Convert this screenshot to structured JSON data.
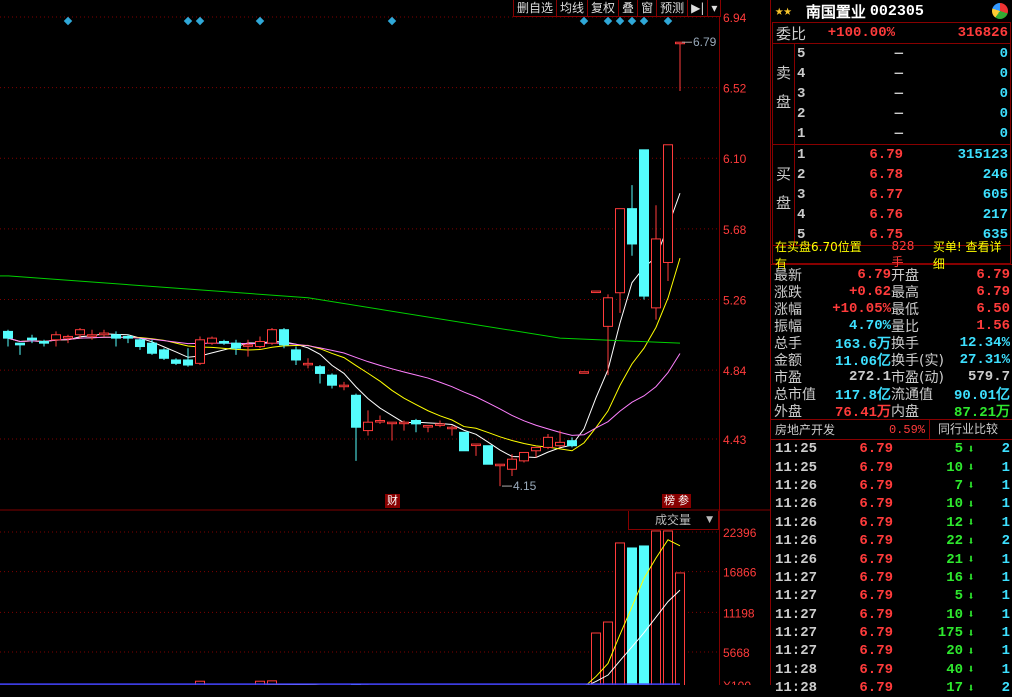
{
  "toolbar": {
    "items": [
      "删自选",
      "均线",
      "复权",
      "叠",
      "窗",
      "预测"
    ],
    "arrow_icon": "expand-right-icon",
    "dropdown_icon": "chevron-down-icon"
  },
  "price_axis": {
    "ticks": [
      "6.94",
      "6.52",
      "6.10",
      "5.68",
      "5.26",
      "4.84",
      "4.43"
    ],
    "max": 6.94,
    "min": 4.43
  },
  "annotations": {
    "high_label": "6.79",
    "low_label": "4.15",
    "finance_badge": "财",
    "rank_badge": "榜",
    "ref_badge": "参"
  },
  "colors": {
    "up": "#ff3b3b",
    "down": "#54fcfc",
    "ma5": "#ffffff",
    "ma10": "#ffff00",
    "ma20": "#ff80ff",
    "ma60": "#00d000",
    "grid": "#800000",
    "diamond": "#2fa8d8"
  },
  "event_marker_candles": [
    5,
    15,
    16,
    21,
    32,
    48,
    50,
    51,
    52,
    53,
    55
  ],
  "candles": [
    [
      5.07,
      5.08,
      4.98,
      5.03
    ],
    [
      5.0,
      5.0,
      4.93,
      4.99
    ],
    [
      5.03,
      5.05,
      5.0,
      5.02
    ],
    [
      5.01,
      5.02,
      4.98,
      5.0
    ],
    [
      5.02,
      5.07,
      4.98,
      5.05
    ],
    [
      5.03,
      5.05,
      5.0,
      5.04
    ],
    [
      5.05,
      5.09,
      5.03,
      5.08
    ],
    [
      5.05,
      5.08,
      5.02,
      5.05
    ],
    [
      5.05,
      5.08,
      5.04,
      5.06
    ],
    [
      5.05,
      5.07,
      4.98,
      5.03
    ],
    [
      5.04,
      5.05,
      5.0,
      5.03
    ],
    [
      5.02,
      5.03,
      4.96,
      4.98
    ],
    [
      5.0,
      5.02,
      4.93,
      4.94
    ],
    [
      4.96,
      4.97,
      4.9,
      4.91
    ],
    [
      4.9,
      4.91,
      4.87,
      4.88
    ],
    [
      4.9,
      4.97,
      4.86,
      4.87
    ],
    [
      4.88,
      5.04,
      4.87,
      5.02
    ],
    [
      5.0,
      5.04,
      4.99,
      5.03
    ],
    [
      5.01,
      5.02,
      4.99,
      5.0
    ],
    [
      5.0,
      5.02,
      4.93,
      4.97
    ],
    [
      4.99,
      5.02,
      4.92,
      4.99
    ],
    [
      4.98,
      5.04,
      4.97,
      5.01
    ],
    [
      5.0,
      5.09,
      4.99,
      5.08
    ],
    [
      5.08,
      5.09,
      4.97,
      4.99
    ],
    [
      4.96,
      4.98,
      4.87,
      4.9
    ],
    [
      4.88,
      4.91,
      4.85,
      4.88
    ],
    [
      4.86,
      4.87,
      4.76,
      4.82
    ],
    [
      4.81,
      4.82,
      4.73,
      4.75
    ],
    [
      4.75,
      4.77,
      4.72,
      4.75
    ],
    [
      4.69,
      4.7,
      4.3,
      4.5
    ],
    [
      4.48,
      4.6,
      4.45,
      4.53
    ],
    [
      4.54,
      4.57,
      4.52,
      4.54
    ],
    [
      4.53,
      4.53,
      4.42,
      4.53
    ],
    [
      4.53,
      4.54,
      4.48,
      4.53
    ],
    [
      4.54,
      4.55,
      4.47,
      4.52
    ],
    [
      4.51,
      4.51,
      4.47,
      4.51
    ],
    [
      4.52,
      4.54,
      4.5,
      4.52
    ],
    [
      4.5,
      4.51,
      4.45,
      4.5
    ],
    [
      4.47,
      4.47,
      4.36,
      4.36
    ],
    [
      4.4,
      4.4,
      4.33,
      4.4
    ],
    [
      4.39,
      4.39,
      4.28,
      4.28
    ],
    [
      4.28,
      4.28,
      4.15,
      4.28
    ],
    [
      4.25,
      4.34,
      4.21,
      4.31
    ],
    [
      4.3,
      4.35,
      4.29,
      4.35
    ],
    [
      4.36,
      4.38,
      4.32,
      4.38
    ],
    [
      4.38,
      4.46,
      4.37,
      4.44
    ],
    [
      4.39,
      4.48,
      4.38,
      4.41
    ],
    [
      4.42,
      4.44,
      4.38,
      4.39
    ],
    [
      4.83,
      4.83,
      4.83,
      4.83
    ],
    [
      5.31,
      5.31,
      5.31,
      5.31
    ],
    [
      5.1,
      5.29,
      4.81,
      5.27
    ],
    [
      5.3,
      5.8,
      5.18,
      5.8
    ],
    [
      5.8,
      5.94,
      5.52,
      5.59
    ],
    [
      6.15,
      6.15,
      5.26,
      5.28
    ],
    [
      5.21,
      5.82,
      5.14,
      5.62
    ],
    [
      5.48,
      6.18,
      5.37,
      6.18
    ],
    [
      6.79,
      6.79,
      6.5,
      6.79
    ]
  ],
  "ma60_anchors": [
    [
      0,
      5.4
    ],
    [
      25,
      5.27
    ],
    [
      46,
      5.03
    ],
    [
      56,
      5.0
    ]
  ],
  "volume": {
    "label": "成交量",
    "ticks": [
      "22396",
      "16866",
      "11198",
      "5668"
    ],
    "unit_label": "X100",
    "max": 22396,
    "values": [
      700,
      650,
      600,
      620,
      800,
      650,
      900,
      700,
      650,
      720,
      600,
      700,
      800,
      750,
      700,
      760,
      1600,
      900,
      700,
      800,
      800,
      1600,
      1650,
      1000,
      900,
      700,
      800,
      900,
      700,
      1100,
      800,
      700,
      800,
      650,
      600,
      700,
      650,
      700,
      800,
      700,
      900,
      800,
      900,
      850,
      900,
      800,
      700,
      800,
      700,
      8320,
      9850,
      20870,
      20170,
      20450,
      22540,
      22540,
      16690
    ],
    "long_ma": 1200
  },
  "quote": {
    "name": "南国置业",
    "code": "002305",
    "stars": "★★",
    "weibi": {
      "label": "委比",
      "pct": "+100.00%",
      "diff": "316826"
    },
    "sell_label": "卖盘",
    "buy_label": "买盘",
    "sell": [
      {
        "lv": "5",
        "price": "—",
        "vol": "0"
      },
      {
        "lv": "4",
        "price": "—",
        "vol": "0"
      },
      {
        "lv": "3",
        "price": "—",
        "vol": "0"
      },
      {
        "lv": "2",
        "price": "—",
        "vol": "0"
      },
      {
        "lv": "1",
        "price": "—",
        "vol": "0"
      }
    ],
    "buy": [
      {
        "lv": "1",
        "price": "6.79",
        "vol": "315123"
      },
      {
        "lv": "2",
        "price": "6.78",
        "vol": "246"
      },
      {
        "lv": "3",
        "price": "6.77",
        "vol": "605"
      },
      {
        "lv": "4",
        "price": "6.76",
        "vol": "217"
      },
      {
        "lv": "5",
        "price": "6.75",
        "vol": "635"
      }
    ],
    "notice": {
      "pre": "在买盘6.70位置有",
      "qty": "828手",
      "post": "买单! 查看详细"
    },
    "stats": [
      {
        "l": "最新",
        "v": "6.79",
        "c": "red",
        "l2": "开盘",
        "v2": "6.79",
        "c2": "red"
      },
      {
        "l": "涨跌",
        "v": "+0.62",
        "c": "red",
        "l2": "最高",
        "v2": "6.79",
        "c2": "red"
      },
      {
        "l": "涨幅",
        "v": "+10.05%",
        "c": "red",
        "l2": "最低",
        "v2": "6.50",
        "c2": "red"
      },
      {
        "l": "振幅",
        "v": "4.70%",
        "c": "cyan",
        "l2": "量比",
        "v2": "1.56",
        "c2": "red"
      },
      {
        "l": "总手",
        "v": "163.6万",
        "c": "cyan",
        "l2": "换手",
        "v2": "12.34%",
        "c2": "cyan"
      },
      {
        "l": "金额",
        "v": "11.06亿",
        "c": "cyan",
        "l2": "换手(实)",
        "v2": "27.31%",
        "c2": "cyan"
      },
      {
        "l": "市盈",
        "v": "272.1",
        "c": "white",
        "l2": "市盈(动)",
        "v2": "579.7",
        "c2": "white"
      },
      {
        "l": "总市值",
        "v": "117.8亿",
        "c": "cyan",
        "l2": "流通值",
        "v2": "90.01亿",
        "c2": "cyan"
      },
      {
        "l": "外盘",
        "v": "76.41万",
        "c": "red",
        "l2": "内盘",
        "v2": "87.21万",
        "c2": "green"
      }
    ],
    "sector": {
      "name": "房地产开发",
      "pct": "0.59%",
      "compare": "同行业比较"
    },
    "trades": [
      {
        "t": "11:25",
        "p": "6.79",
        "q": "5",
        "n": "2"
      },
      {
        "t": "11:25",
        "p": "6.79",
        "q": "10",
        "n": "1"
      },
      {
        "t": "11:26",
        "p": "6.79",
        "q": "7",
        "n": "1"
      },
      {
        "t": "11:26",
        "p": "6.79",
        "q": "10",
        "n": "1"
      },
      {
        "t": "11:26",
        "p": "6.79",
        "q": "12",
        "n": "1"
      },
      {
        "t": "11:26",
        "p": "6.79",
        "q": "22",
        "n": "2"
      },
      {
        "t": "11:26",
        "p": "6.79",
        "q": "21",
        "n": "1"
      },
      {
        "t": "11:27",
        "p": "6.79",
        "q": "16",
        "n": "1"
      },
      {
        "t": "11:27",
        "p": "6.79",
        "q": "5",
        "n": "1"
      },
      {
        "t": "11:27",
        "p": "6.79",
        "q": "10",
        "n": "1"
      },
      {
        "t": "11:27",
        "p": "6.79",
        "q": "175",
        "n": "1"
      },
      {
        "t": "11:27",
        "p": "6.79",
        "q": "20",
        "n": "1"
      },
      {
        "t": "11:28",
        "p": "6.79",
        "q": "40",
        "n": "1"
      },
      {
        "t": "11:28",
        "p": "6.79",
        "q": "17",
        "n": "2"
      }
    ]
  }
}
